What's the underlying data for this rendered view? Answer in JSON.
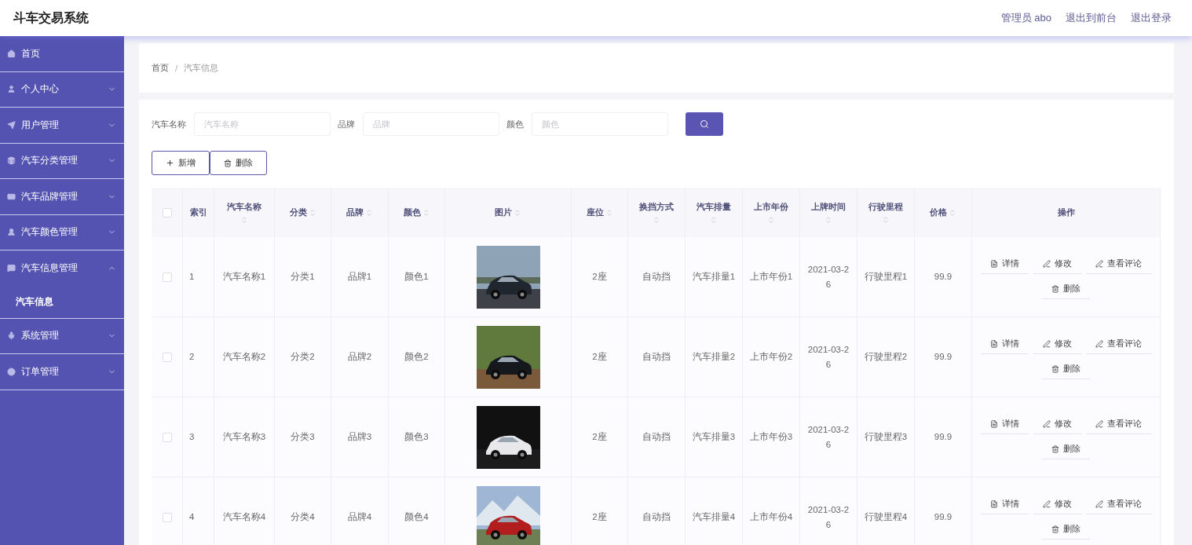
{
  "app_title": "斗车交易系统",
  "top_links": [
    "管理员 abo",
    "退出到前台",
    "退出登录"
  ],
  "sidebar": {
    "items": [
      {
        "label": "首页",
        "kind": "link"
      },
      {
        "label": "个人中心",
        "kind": "submenu",
        "expanded": false
      },
      {
        "label": "用户管理",
        "kind": "submenu",
        "expanded": false
      },
      {
        "label": "汽车分类管理",
        "kind": "submenu",
        "expanded": false
      },
      {
        "label": "汽车品牌管理",
        "kind": "submenu",
        "expanded": false
      },
      {
        "label": "汽车颜色管理",
        "kind": "submenu",
        "expanded": false
      },
      {
        "label": "汽车信息管理",
        "kind": "submenu",
        "expanded": true,
        "children": [
          {
            "label": "汽车信息",
            "selected": true
          }
        ]
      },
      {
        "label": "系统管理",
        "kind": "submenu",
        "expanded": false
      },
      {
        "label": "订单管理",
        "kind": "submenu",
        "expanded": false
      }
    ]
  },
  "breadcrumb": {
    "items": [
      "首页",
      "汽车信息"
    ],
    "separator": "/"
  },
  "search": {
    "fields": [
      {
        "label": "汽车名称",
        "placeholder": "汽车名称"
      },
      {
        "label": "品牌",
        "placeholder": "品牌"
      },
      {
        "label": "颜色",
        "placeholder": "颜色"
      }
    ]
  },
  "actions": [
    {
      "kind": "add",
      "label": "新增"
    },
    {
      "kind": "delete",
      "label": "删除"
    }
  ],
  "table": {
    "columns": [
      {
        "kind": "checkbox",
        "checked": false
      },
      {
        "kind": "text",
        "label": "索引",
        "sortable": false
      },
      {
        "kind": "text",
        "label": "汽车名称",
        "sortable": true
      },
      {
        "kind": "text",
        "label": "分类",
        "sortable": true
      },
      {
        "kind": "text",
        "label": "品牌",
        "sortable": true
      },
      {
        "kind": "text",
        "label": "颜色",
        "sortable": true
      },
      {
        "kind": "text",
        "label": "图片",
        "sortable": true
      },
      {
        "kind": "text",
        "label": "座位",
        "sortable": true
      },
      {
        "kind": "text",
        "label": "换挡方式",
        "sortable": true
      },
      {
        "kind": "text",
        "label": "汽车排量",
        "sortable": true
      },
      {
        "kind": "text",
        "label": "上市年份",
        "sortable": true
      },
      {
        "kind": "text",
        "label": "上牌时间",
        "sortable": true
      },
      {
        "kind": "text",
        "label": "行驶里程",
        "sortable": true
      },
      {
        "kind": "text",
        "label": "价格",
        "sortable": true
      },
      {
        "kind": "text",
        "label": "操作",
        "sortable": false
      }
    ],
    "rows": [
      {
        "cells": [
          {
            "kind": "checkbox",
            "checked": false
          },
          {
            "text": "1"
          },
          {
            "text": "汽车名称1"
          },
          {
            "text": "分类1"
          },
          {
            "text": "品牌1"
          },
          {
            "text": "颜色1"
          },
          {
            "kind": "picture"
          },
          {
            "text": "2座"
          },
          {
            "text": "自动挡"
          },
          {
            "text": "汽车排量1"
          },
          {
            "text": "上市年份1"
          },
          {
            "text": "2021-03-26"
          },
          {
            "text": "行驶里程1"
          },
          {
            "text": "99.9"
          },
          {
            "kind": "actions",
            "actions": [
              {
                "kind": "detail",
                "label": "详情"
              },
              {
                "kind": "edit",
                "label": "修改"
              },
              {
                "kind": "comment",
                "label": "查看评论"
              },
              {
                "kind": "delete",
                "label": "删除"
              }
            ]
          }
        ]
      },
      {
        "cells": [
          {
            "kind": "checkbox",
            "checked": false
          },
          {
            "text": "2"
          },
          {
            "text": "汽车名称2"
          },
          {
            "text": "分类2"
          },
          {
            "text": "品牌2"
          },
          {
            "text": "颜色2"
          },
          {
            "kind": "picture"
          },
          {
            "text": "2座"
          },
          {
            "text": "自动挡"
          },
          {
            "text": "汽车排量2"
          },
          {
            "text": "上市年份2"
          },
          {
            "text": "2021-03-26"
          },
          {
            "text": "行驶里程2"
          },
          {
            "text": "99.9"
          },
          {
            "kind": "actions",
            "actions": [
              {
                "kind": "detail",
                "label": "详情"
              },
              {
                "kind": "edit",
                "label": "修改"
              },
              {
                "kind": "comment",
                "label": "查看评论"
              },
              {
                "kind": "delete",
                "label": "删除"
              }
            ]
          }
        ]
      },
      {
        "cells": [
          {
            "kind": "checkbox",
            "checked": false
          },
          {
            "text": "3"
          },
          {
            "text": "汽车名称3"
          },
          {
            "text": "分类3"
          },
          {
            "text": "品牌3"
          },
          {
            "text": "颜色3"
          },
          {
            "kind": "picture"
          },
          {
            "text": "2座"
          },
          {
            "text": "自动挡"
          },
          {
            "text": "汽车排量3"
          },
          {
            "text": "上市年份3"
          },
          {
            "text": "2021-03-26"
          },
          {
            "text": "行驶里程3"
          },
          {
            "text": "99.9"
          },
          {
            "kind": "actions",
            "actions": [
              {
                "kind": "detail",
                "label": "详情"
              },
              {
                "kind": "edit",
                "label": "修改"
              },
              {
                "kind": "comment",
                "label": "查看评论"
              },
              {
                "kind": "delete",
                "label": "删除"
              }
            ]
          }
        ]
      },
      {
        "cells": [
          {
            "kind": "checkbox",
            "checked": false
          },
          {
            "text": "4"
          },
          {
            "text": "汽车名称4"
          },
          {
            "text": "分类4"
          },
          {
            "text": "品牌4"
          },
          {
            "text": "颜色4"
          },
          {
            "kind": "picture"
          },
          {
            "text": "2座"
          },
          {
            "text": "自动挡"
          },
          {
            "text": "汽车排量4"
          },
          {
            "text": "上市年份4"
          },
          {
            "text": "2021-03-26"
          },
          {
            "text": "行驶里程4"
          },
          {
            "text": "99.9"
          },
          {
            "kind": "actions",
            "actions": [
              {
                "kind": "detail",
                "label": "详情"
              },
              {
                "kind": "edit",
                "label": "修改"
              },
              {
                "kind": "comment",
                "label": "查看评论"
              },
              {
                "kind": "delete",
                "label": "删除"
              }
            ]
          }
        ]
      }
    ]
  }
}
